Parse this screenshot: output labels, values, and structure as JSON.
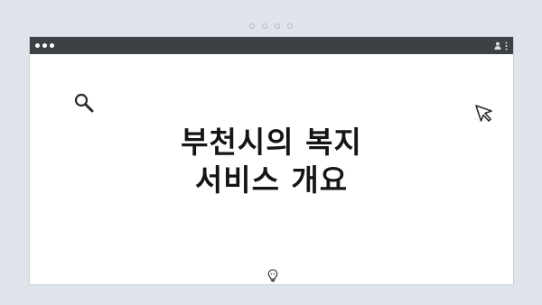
{
  "window": {
    "title_lines": [
      "부천시의 복지",
      "서비스 개요"
    ]
  },
  "icons": {
    "top_left": "search-icon",
    "top_right": "cursor-arrow-icon",
    "bottom": "lightbulb-icon",
    "titlebar_right": [
      "user-icon",
      "menu-dots-icon"
    ]
  },
  "colors": {
    "background": "#dfe4ea",
    "titlebar": "#3d4045",
    "title_text": "#151515"
  }
}
